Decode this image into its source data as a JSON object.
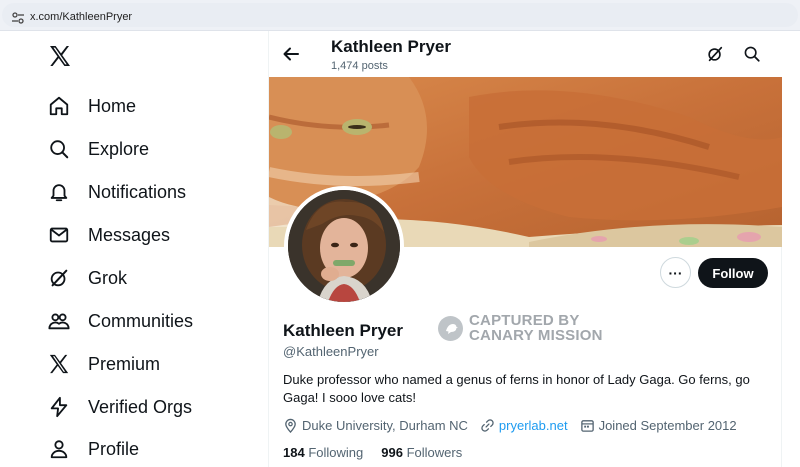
{
  "browser": {
    "url": "x.com/KathleenPryer",
    "site_info_icon": "tune-icon"
  },
  "sidebar": {
    "logo_icon": "x-logo-icon",
    "items": [
      {
        "label": "Home",
        "icon": "home-icon"
      },
      {
        "label": "Explore",
        "icon": "search-icon"
      },
      {
        "label": "Notifications",
        "icon": "bell-icon"
      },
      {
        "label": "Messages",
        "icon": "envelope-icon"
      },
      {
        "label": "Grok",
        "icon": "grok-icon"
      },
      {
        "label": "Communities",
        "icon": "people-icon"
      },
      {
        "label": "Premium",
        "icon": "x-logo-icon"
      },
      {
        "label": "Verified Orgs",
        "icon": "lightning-icon"
      },
      {
        "label": "Profile",
        "icon": "person-icon"
      }
    ]
  },
  "header": {
    "title": "Kathleen Pryer",
    "posts": "1,474 posts"
  },
  "profile": {
    "name": "Kathleen Pryer",
    "handle": "@KathleenPryer",
    "bio": "Duke professor who named a genus of ferns in honor of Lady Gaga. Go ferns, go Gaga! I sooo love cats!",
    "location": "Duke University, Durham NC",
    "website": "pryerlab.net",
    "joined": "Joined September 2012",
    "following_count": "184",
    "following_label": "Following",
    "followers_count": "996",
    "followers_label": "Followers",
    "follow_button": "Follow",
    "more_button": "···"
  },
  "watermark": {
    "line1": "CAPTURED BY",
    "line2": "CANARY MISSION"
  },
  "colors": {
    "accent": "#1d9bf0",
    "text": "#0f1419",
    "muted": "#536471",
    "button_dark": "#0f1419"
  }
}
